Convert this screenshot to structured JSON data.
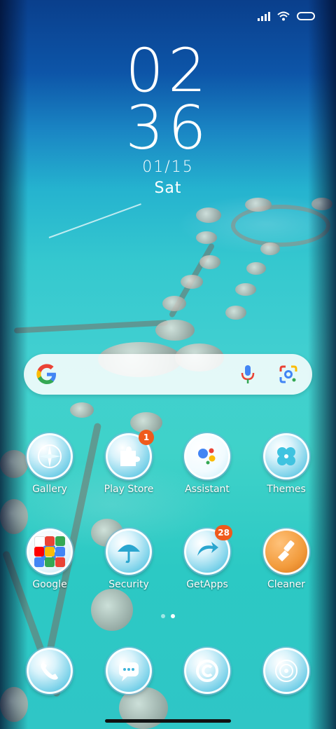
{
  "clock": {
    "hours": "02",
    "minutes": "36",
    "date": "01/15",
    "day": "Sat"
  },
  "apps": [
    {
      "label": "Gallery",
      "icon": "compass-icon",
      "badge": ""
    },
    {
      "label": "Play Store",
      "icon": "puzzle-icon",
      "badge": "1"
    },
    {
      "label": "Assistant",
      "icon": "assistant-icon",
      "badge": ""
    },
    {
      "label": "Themes",
      "icon": "clover-icon",
      "badge": ""
    },
    {
      "label": "Google",
      "icon": "folder-icon",
      "badge": ""
    },
    {
      "label": "Security",
      "icon": "umbrella-icon",
      "badge": ""
    },
    {
      "label": "GetApps",
      "icon": "arrow-icon",
      "badge": "28"
    },
    {
      "label": "Cleaner",
      "icon": "brush-icon",
      "badge": ""
    }
  ],
  "dock": [
    {
      "icon": "phone-icon"
    },
    {
      "icon": "message-icon"
    },
    {
      "icon": "browser-icon"
    },
    {
      "icon": "camera-icon"
    }
  ],
  "colors": {
    "badge": "#ef5a1c",
    "accent": "#3fb4d9"
  }
}
